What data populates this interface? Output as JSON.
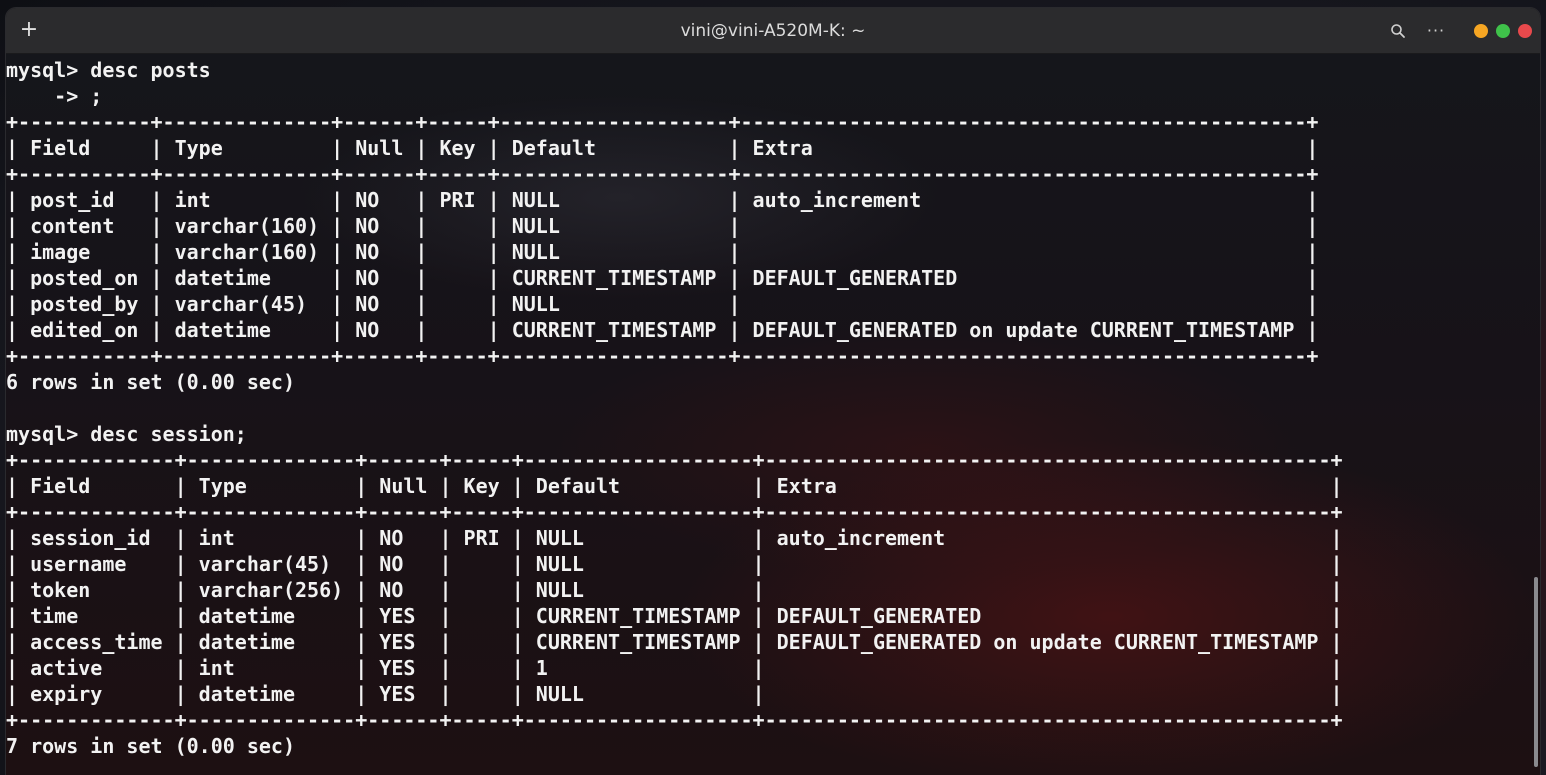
{
  "window": {
    "title": "vini@vini-A520M-K: ~",
    "new_tab_label": "+",
    "menu_label": "···"
  },
  "icons": {
    "new_tab": "plus-icon",
    "search": "search-icon",
    "menu": "menu-dots-icon",
    "minimize": "minimize-icon",
    "maximize": "maximize-icon",
    "close": "close-icon"
  },
  "colors": {
    "titlebar": "#2b2b2d",
    "terminal_text": "#f2f2f2",
    "minimize": "#f6a623",
    "maximize": "#3fc24a",
    "close": "#e8494c"
  },
  "terminal": {
    "lines": [
      "mysql> desc posts",
      "    -> ;",
      "+-----------+--------------+------+-----+-------------------+-----------------------------------------------+",
      "| Field     | Type         | Null | Key | Default           | Extra                                         |",
      "+-----------+--------------+------+-----+-------------------+-----------------------------------------------+",
      "| post_id   | int          | NO   | PRI | NULL              | auto_increment                                |",
      "| content   | varchar(160) | NO   |     | NULL              |                                               |",
      "| image     | varchar(160) | NO   |     | NULL              |                                               |",
      "| posted_on | datetime     | NO   |     | CURRENT_TIMESTAMP | DEFAULT_GENERATED                             |",
      "| posted_by | varchar(45)  | NO   |     | NULL              |                                               |",
      "| edited_on | datetime     | NO   |     | CURRENT_TIMESTAMP | DEFAULT_GENERATED on update CURRENT_TIMESTAMP |",
      "+-----------+--------------+------+-----+-------------------+-----------------------------------------------+",
      "6 rows in set (0.00 sec)",
      "",
      "mysql> desc session;",
      "+-------------+--------------+------+-----+-------------------+-----------------------------------------------+",
      "| Field       | Type         | Null | Key | Default           | Extra                                         |",
      "+-------------+--------------+------+-----+-------------------+-----------------------------------------------+",
      "| session_id  | int          | NO   | PRI | NULL              | auto_increment                                |",
      "| username    | varchar(45)  | NO   |     | NULL              |                                               |",
      "| token       | varchar(256) | NO   |     | NULL              |                                               |",
      "| time        | datetime     | YES  |     | CURRENT_TIMESTAMP | DEFAULT_GENERATED                             |",
      "| access_time | datetime     | YES  |     | CURRENT_TIMESTAMP | DEFAULT_GENERATED on update CURRENT_TIMESTAMP |",
      "| active      | int          | YES  |     | 1                 |                                               |",
      "| expiry      | datetime     | YES  |     | NULL              |                                               |",
      "+-------------+--------------+------+-----+-------------------+-----------------------------------------------+",
      "7 rows in set (0.00 sec)"
    ]
  }
}
